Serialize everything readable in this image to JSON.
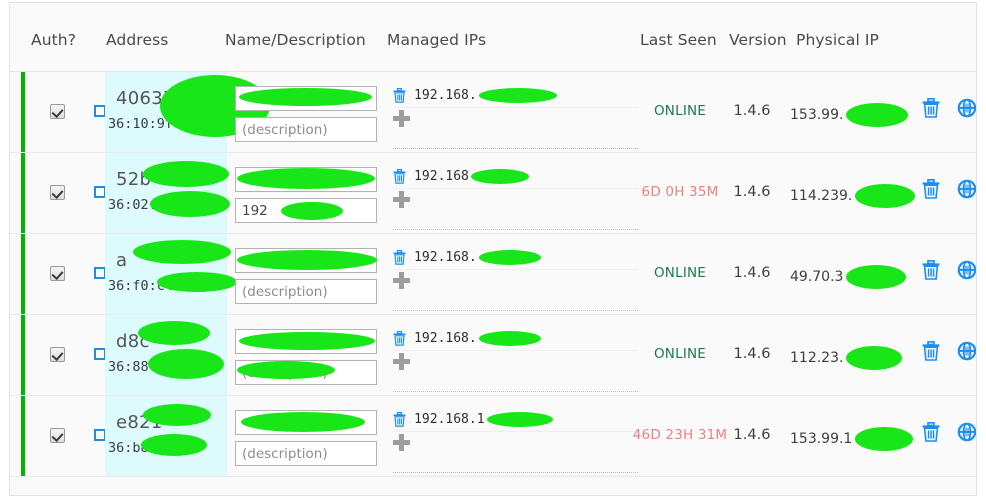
{
  "table": {
    "columns": [
      {
        "key": "auth",
        "label": "Auth?"
      },
      {
        "key": "address",
        "label": "Address"
      },
      {
        "key": "name",
        "label": "Name/Description"
      },
      {
        "key": "managed",
        "label": "Managed IPs"
      },
      {
        "key": "lastseen",
        "label": "Last Seen"
      },
      {
        "key": "version",
        "label": "Version"
      },
      {
        "key": "physical",
        "label": "Physical IP"
      }
    ],
    "placeholders": {
      "name": "",
      "description": "(description)"
    },
    "colors": {
      "row_flag_authorized": "#00b400",
      "address_highlight": "#ddfbfd",
      "status_online": "#1a7a4c",
      "status_offline": "#f08080",
      "action_icon": "#1b8ef2",
      "redaction": "#19e619"
    },
    "icons": {
      "delete_ip": "trash-icon",
      "add_ip": "plus-icon",
      "delete_member": "trash-icon",
      "member_options": "globe-icon"
    },
    "rows": [
      {
        "auth_checked": true,
        "bridge_checked": false,
        "address_id": "40637",
        "address_mac": "36:10:9f",
        "name_value": "",
        "description_value": "",
        "description_placeholder": "(description)",
        "managed_ip": "192.168.",
        "last_seen": "ONLINE",
        "status": "online",
        "version": "1.4.6",
        "physical_ip": "153.99."
      },
      {
        "auth_checked": true,
        "bridge_checked": false,
        "address_id": "52b",
        "address_mac": "36:02:43",
        "name_value": "",
        "description_value": "192",
        "description_placeholder": "(description)",
        "managed_ip": "192.168",
        "last_seen": "6D 0H 35M",
        "status": "offline",
        "version": "1.4.6",
        "physical_ip": "114.239."
      },
      {
        "auth_checked": true,
        "bridge_checked": false,
        "address_id": "a",
        "address_mac": "36:f0:c4",
        "name_value": "",
        "description_value": "",
        "description_placeholder": "(description)",
        "managed_ip": "192.168.",
        "last_seen": "ONLINE",
        "status": "online",
        "version": "1.4.6",
        "physical_ip": "49.70.3"
      },
      {
        "auth_checked": true,
        "bridge_checked": false,
        "address_id": "d8c",
        "address_mac": "36:88:",
        "name_value": "",
        "description_value": "",
        "description_placeholder": "(description)",
        "managed_ip": "192.168.",
        "last_seen": "ONLINE",
        "status": "online",
        "version": "1.4.6",
        "physical_ip": "112.23."
      },
      {
        "auth_checked": true,
        "bridge_checked": false,
        "address_id": "e821",
        "address_mac": "36:b8:d",
        "name_value": "",
        "description_value": "",
        "description_placeholder": "(description)",
        "managed_ip": "192.168.1",
        "last_seen": "46D 23H 31M",
        "status": "offline",
        "version": "1.4.6",
        "physical_ip": "153.99.1"
      }
    ]
  }
}
